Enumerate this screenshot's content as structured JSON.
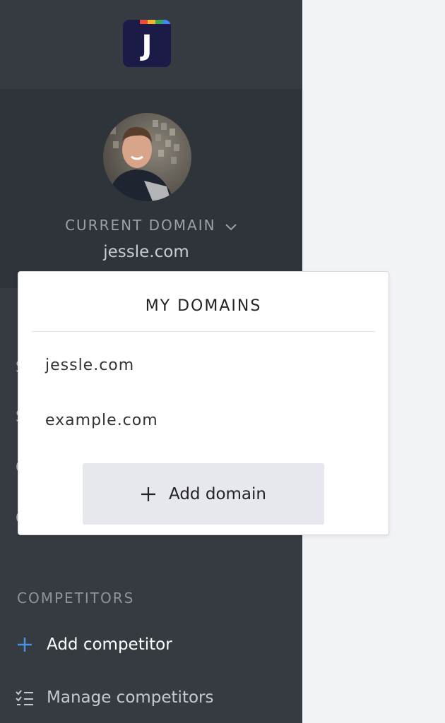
{
  "logo": {
    "letter": "J",
    "stripe_colors": [
      "#e94b3c",
      "#f2b42d",
      "#3aa757",
      "#4285f4"
    ]
  },
  "profile": {
    "current_domain_label": "CURRENT DOMAIN",
    "current_domain_value": "jessle.com"
  },
  "sidebar_peek": [
    "S",
    "S",
    "C",
    "C"
  ],
  "competitors": {
    "heading": "COMPETITORS",
    "add_label": "Add competitor",
    "manage_label": "Manage competitors"
  },
  "domain_menu": {
    "title": "MY DOMAINS",
    "options": [
      "jessle.com",
      "example.com"
    ],
    "add_label": "Add domain"
  },
  "colors": {
    "sidebar": "#363a41",
    "profile_panel": "#2f333a",
    "accent_plus": "#4a90e2",
    "content_bg": "#f2f3f6"
  },
  "icons": {
    "chevron": "chevron-down-icon",
    "add": "plus-icon",
    "manage": "checklist-icon"
  }
}
